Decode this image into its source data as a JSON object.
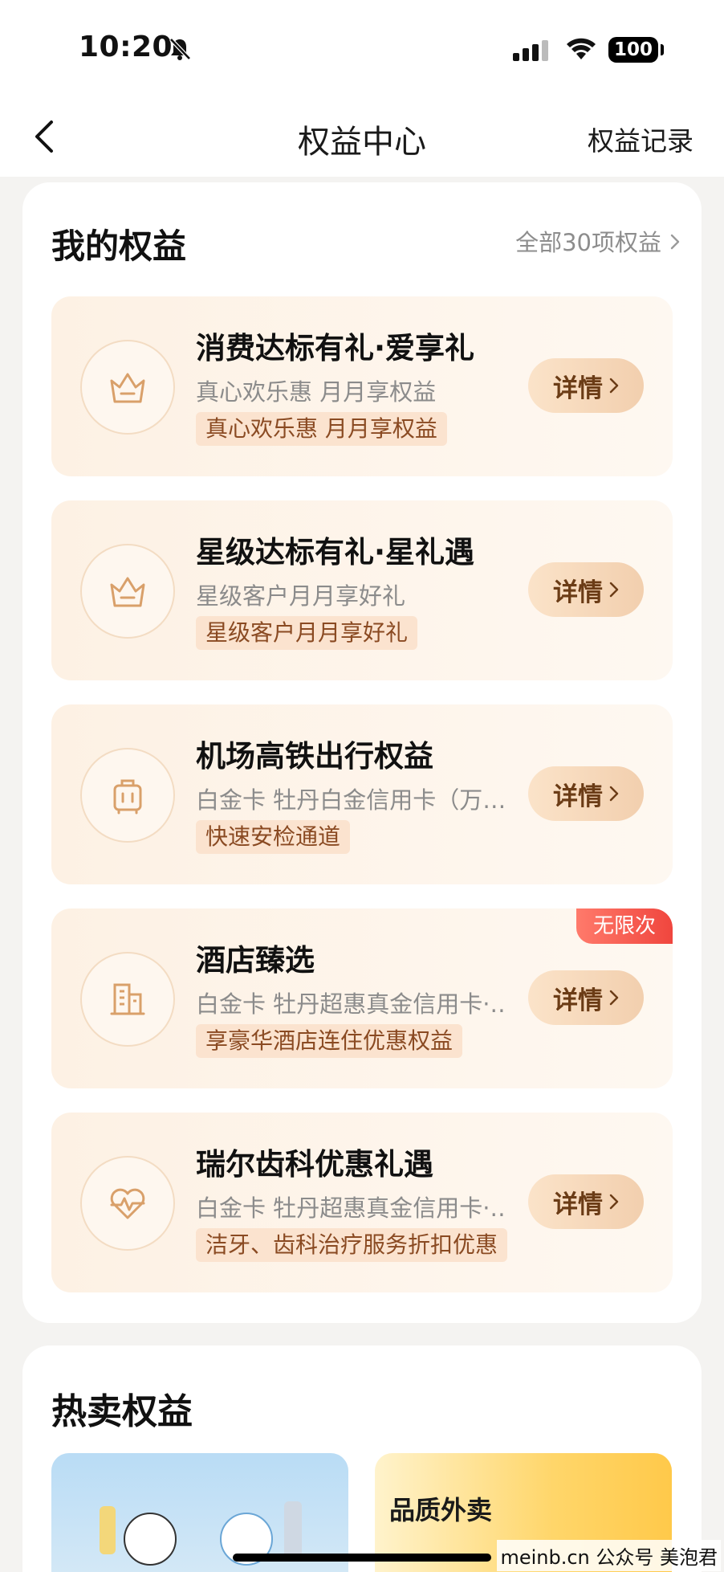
{
  "status_bar": {
    "time": "10:20",
    "battery": "100"
  },
  "nav": {
    "title": "权益中心",
    "right_link": "权益记录"
  },
  "my_benefits": {
    "title": "我的权益",
    "all_link": "全部30项权益",
    "items": [
      {
        "title": "消费达标有礼·爱享礼",
        "subtitle": "真心欢乐惠 月月享权益",
        "tag": "真心欢乐惠 月月享权益",
        "button": "详情",
        "icon": "gift-basket-icon",
        "badge": ""
      },
      {
        "title": "星级达标有礼·星礼遇",
        "subtitle": "星级客户月月享好礼",
        "tag": "星级客户月月享好礼",
        "button": "详情",
        "icon": "gift-basket-icon",
        "badge": ""
      },
      {
        "title": "机场高铁出行权益",
        "subtitle": "白金卡 牡丹白金信用卡（万…",
        "tag": "快速安检通道",
        "button": "详情",
        "icon": "luggage-icon",
        "badge": ""
      },
      {
        "title": "酒店臻选",
        "subtitle": "白金卡 牡丹超惠真金信用卡·…",
        "tag": "享豪华酒店连住优惠权益",
        "button": "详情",
        "icon": "hotel-building-icon",
        "badge": "无限次"
      },
      {
        "title": "瑞尔齿科优惠礼遇",
        "subtitle": "白金卡 牡丹超惠真金信用卡·…",
        "tag": "洁牙、齿科治疗服务折扣优惠",
        "button": "详情",
        "icon": "heart-pulse-icon",
        "badge": ""
      }
    ]
  },
  "hot_benefits": {
    "title": "热卖权益",
    "cards": [
      {
        "label": ""
      },
      {
        "label": "品质外卖"
      }
    ]
  },
  "watermark": "meinb.cn 公众号 美泡君",
  "colors": {
    "accent": "#d9a06a",
    "button_text": "#6b3c16",
    "badge": "#f0463e"
  }
}
